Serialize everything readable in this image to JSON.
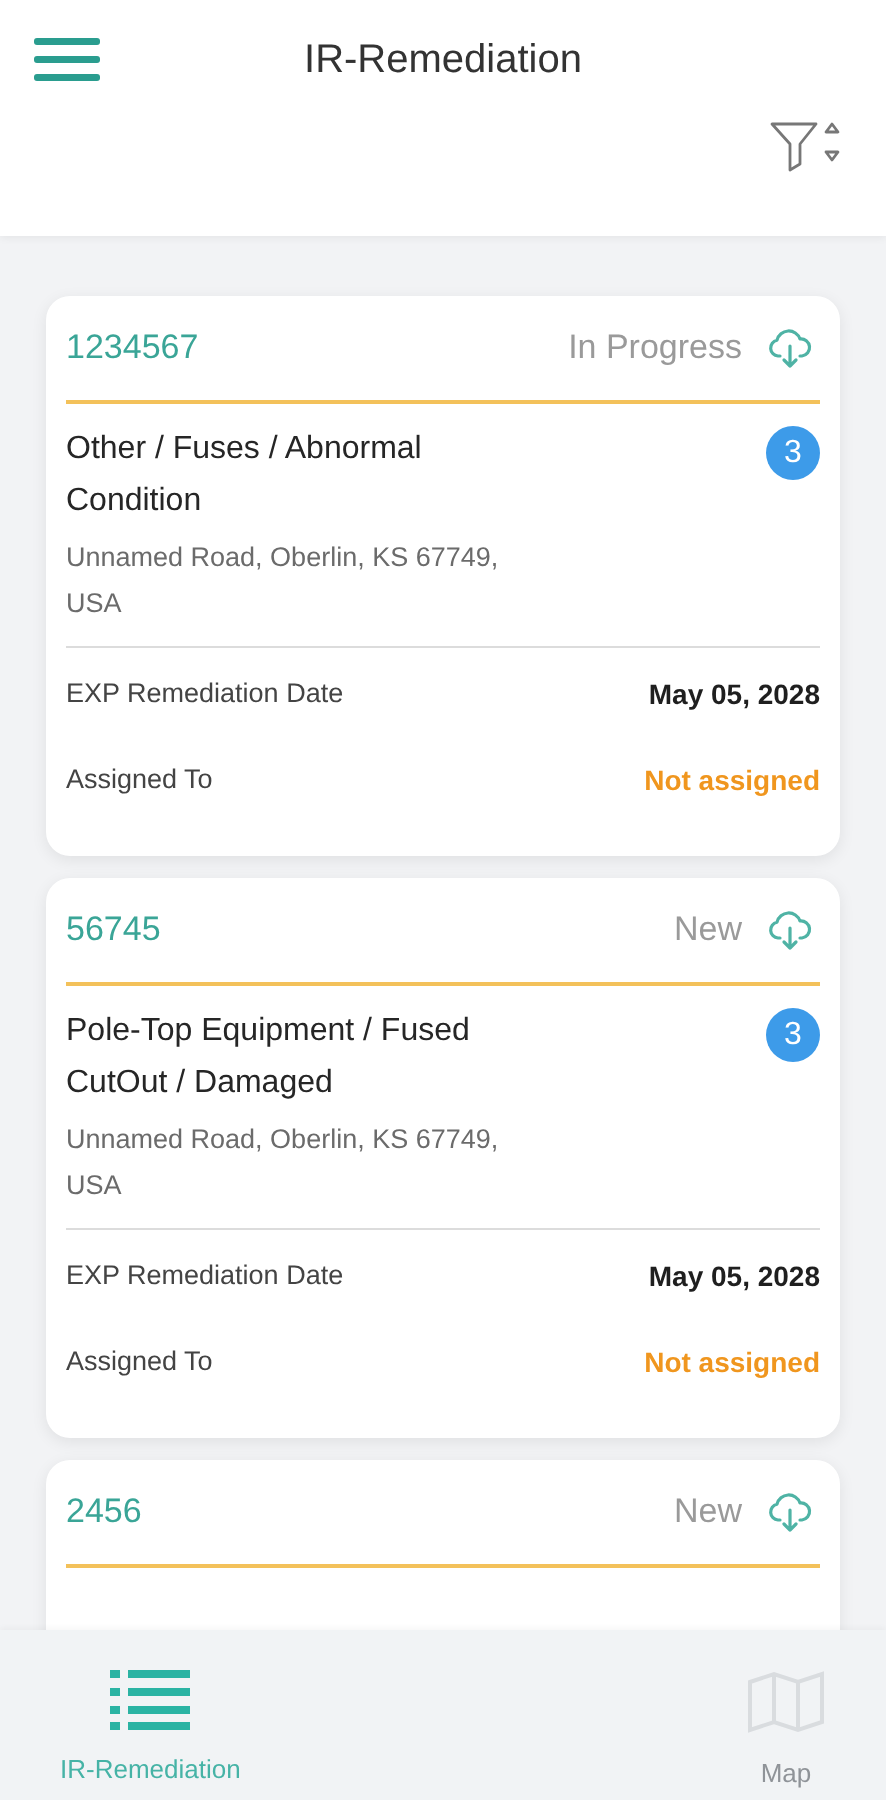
{
  "header": {
    "title": "IR-Remediation"
  },
  "cards": [
    {
      "id": "1234567",
      "status": "In Progress",
      "title": "Other / Fuses / Abnormal Condition",
      "count": "3",
      "address": "Unnamed Road, Oberlin, KS 67749, USA",
      "fields": [
        {
          "label": "EXP Remediation Date",
          "value": "May 05, 2028",
          "kind": "date"
        },
        {
          "label": "Assigned To",
          "value": "Not assigned",
          "kind": "warning"
        }
      ]
    },
    {
      "id": "56745",
      "status": "New",
      "title": "Pole-Top Equipment / Fused CutOut / Damaged",
      "count": "3",
      "address": "Unnamed Road, Oberlin, KS 67749, USA",
      "fields": [
        {
          "label": "EXP Remediation Date",
          "value": "May 05, 2028",
          "kind": "date"
        },
        {
          "label": "Assigned To",
          "value": "Not assigned",
          "kind": "warning"
        }
      ]
    },
    {
      "id": "2456",
      "status": "New"
    }
  ],
  "tabs": [
    {
      "label": "IR-Remediation",
      "selected": true,
      "kind": "list"
    },
    {
      "label": "Map",
      "selected": false,
      "kind": "map"
    }
  ]
}
